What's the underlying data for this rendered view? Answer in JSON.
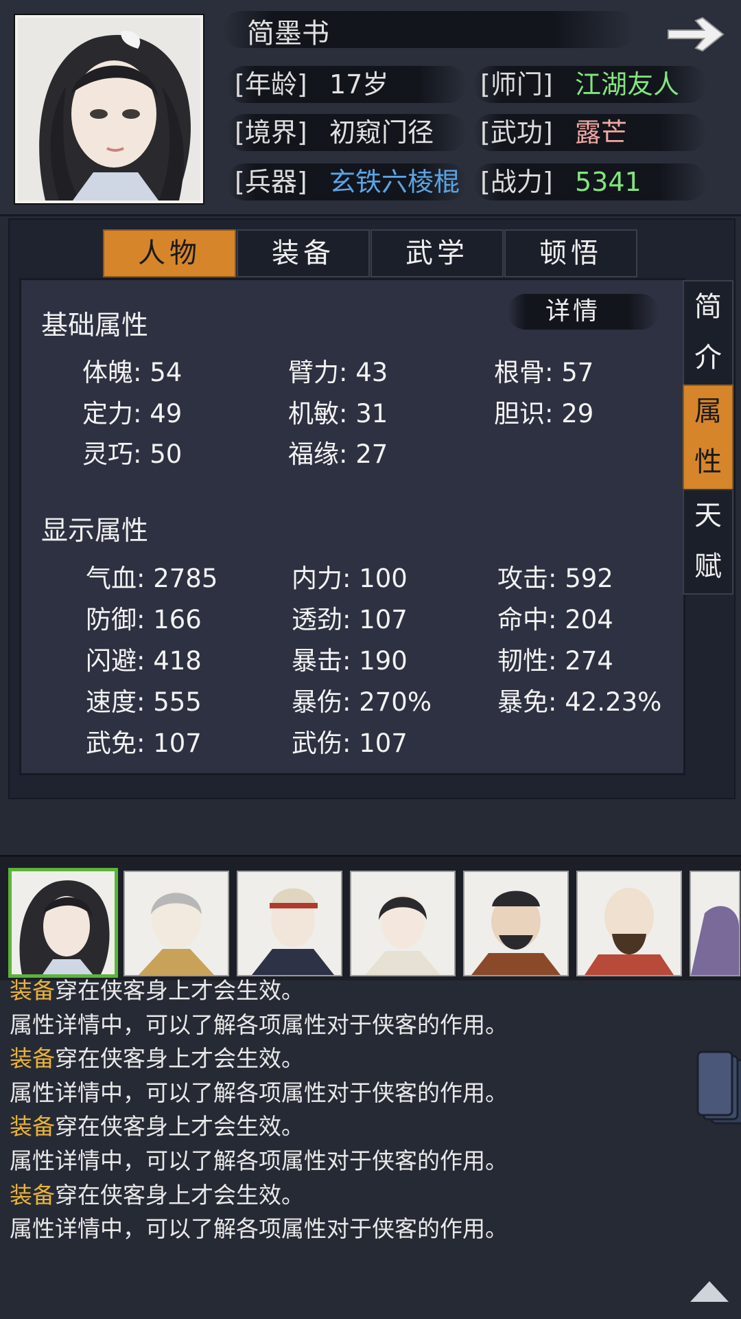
{
  "header": {
    "name": "简墨书",
    "rows": [
      {
        "label": "[年龄]",
        "value": "17岁",
        "label2": "[师门]",
        "value2": "江湖友人"
      },
      {
        "label": "[境界]",
        "value": "初窥门径",
        "label2": "[武功]",
        "value2": "露芒"
      },
      {
        "label": "[兵器]",
        "value": "玄铁六棱棍",
        "label2": "[战力]",
        "value2": "5341"
      }
    ]
  },
  "tabs": [
    "人物",
    "装备",
    "武学",
    "顿悟"
  ],
  "active_tab": "人物",
  "side_tabs": [
    {
      "chars": [
        "简",
        "介"
      ]
    },
    {
      "chars": [
        "属",
        "性"
      ],
      "active": true
    },
    {
      "chars": [
        "天",
        "赋"
      ]
    }
  ],
  "detail_button": "详情",
  "basic": {
    "title": "基础属性",
    "stats": [
      "体魄: 54",
      "臂力: 43",
      "根骨: 57",
      "定力: 49",
      "机敏: 31",
      "胆识: 29",
      "灵巧: 50",
      "福缘: 27"
    ]
  },
  "display": {
    "title": "显示属性",
    "stats": [
      "气血: 2785",
      "内力: 100",
      "攻击: 592",
      "防御: 166",
      "透劲: 107",
      "命中: 204",
      "闪避: 418",
      "暴击: 190",
      "韧性: 274",
      "速度: 555",
      "暴伤: 270%",
      "暴免: 42.23%",
      "武免: 107",
      "武伤: 107"
    ]
  },
  "log": [
    {
      "hl": "装备",
      "rest": "穿在侠客身上才会生效。"
    },
    {
      "hl": "",
      "rest": "属性详情中，可以了解各项属性对于侠客的作用。"
    },
    {
      "hl": "装备",
      "rest": "穿在侠客身上才会生效。"
    },
    {
      "hl": "",
      "rest": "属性详情中，可以了解各项属性对于侠客的作用。"
    },
    {
      "hl": "装备",
      "rest": "穿在侠客身上才会生效。"
    },
    {
      "hl": "",
      "rest": "属性详情中，可以了解各项属性对于侠客的作用。"
    },
    {
      "hl": "装备",
      "rest": "穿在侠客身上才会生效。"
    },
    {
      "hl": "",
      "rest": "属性详情中，可以了解各项属性对于侠客的作用。"
    }
  ],
  "colors": {
    "accent": "#d6852a",
    "green": "#82e57d",
    "pink": "#f2a9a2",
    "blue": "#5aa4e6",
    "highlight": "#e8b23c"
  },
  "icons": [
    "next-arrow-icon",
    "scroll-top-icon",
    "card-deck-icon"
  ]
}
